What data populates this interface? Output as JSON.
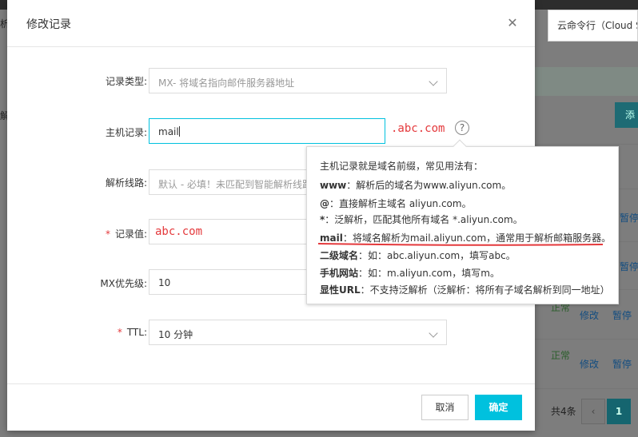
{
  "background": {
    "tooltip_text": "云命令行（Cloud Shell）",
    "add_button_label": "添",
    "left_fragments": [
      "析",
      "解"
    ],
    "rows": [
      {
        "status": "",
        "edit": "",
        "pause": "暂停"
      },
      {
        "status": "",
        "edit": "",
        "pause": "暂停"
      },
      {
        "status": "正常",
        "edit": "修改",
        "pause": "暂停"
      },
      {
        "status": "正常",
        "edit": "修改",
        "pause": "暂停"
      }
    ],
    "total_text": "共4条",
    "pager": {
      "prev": "‹",
      "current_page": "1"
    }
  },
  "modal": {
    "title": "修改记录",
    "close_icon": "close-icon",
    "fields": {
      "record_type": {
        "label": "记录类型:",
        "value": "MX- 将域名指向邮件服务器地址"
      },
      "host": {
        "label": "主机记录:",
        "value": "mail",
        "suffix": ".abc.com"
      },
      "line": {
        "label": "解析线路:",
        "value": "默认 - 必填！未匹配到智能解析线路"
      },
      "record_value": {
        "label": "记录值:",
        "value": "abc.com",
        "required": "*"
      },
      "mx_priority": {
        "label": "MX优先级:",
        "value": "10"
      },
      "ttl": {
        "label": "TTL:",
        "value": "10 分钟",
        "required": "*"
      }
    },
    "help_icon": "question-circle-icon",
    "help_popover": {
      "intro": "主机记录就是域名前缀，常见用法有：",
      "items": [
        {
          "key": "www",
          "text": "：解析后的域名为www.aliyun.com。"
        },
        {
          "key": "@",
          "text": "：直接解析主域名 aliyun.com。"
        },
        {
          "key": "*",
          "text": "：泛解析，匹配其他所有域名 *.aliyun.com。"
        },
        {
          "key": "mail",
          "text": "：将域名解析为mail.aliyun.com，通常用于解析邮箱服务器。"
        },
        {
          "key": "二级域名",
          "text": "：如：abc.aliyun.com，填写abc。"
        },
        {
          "key": "手机网站",
          "text": "：如：m.aliyun.com，填写m。"
        },
        {
          "key": "显性URL",
          "text": "：不支持泛解析（泛解析：将所有子域名解析到同一地址）"
        }
      ]
    },
    "buttons": {
      "cancel": "取消",
      "ok": "确定"
    }
  },
  "colors": {
    "accent": "#00c1de",
    "required": "#e4393c",
    "annotation": "#e4393c"
  }
}
